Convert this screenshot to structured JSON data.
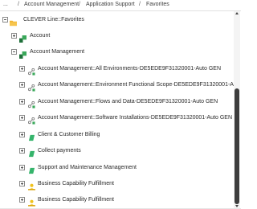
{
  "breadcrumb": {
    "items": [
      "/",
      "Account Management",
      "/",
      "Application Support",
      "/",
      "Favorites"
    ],
    "leading": "..."
  },
  "tree": {
    "root": {
      "label": "CLEVER Line::Favorites",
      "state": "expanded",
      "icon": "folder-icon"
    },
    "nodes": [
      {
        "label": "Account",
        "state": "collapsed",
        "icon": "capability-icon",
        "depth": 1
      },
      {
        "label": "Account Management",
        "state": "expanded",
        "icon": "capability-icon",
        "depth": 1
      },
      {
        "label": "Account Management::All Environments-DE5EDE9F31320001-Auto GEN",
        "state": "collapsed",
        "icon": "relation-icon",
        "depth": 2
      },
      {
        "label": "Account Management::Environment Functional Scope-DE5EDE9F31320001-Auto GEN",
        "state": "collapsed",
        "icon": "relation-icon",
        "depth": 2
      },
      {
        "label": "Account Management::Flows and Data-DE5EDE9F31320001-Auto GEN",
        "state": "collapsed",
        "icon": "relation-icon",
        "depth": 2
      },
      {
        "label": "Account Management::Software Installations-DE5EDE9F31320001-Auto GEN",
        "state": "collapsed",
        "icon": "relation-icon",
        "depth": 2
      },
      {
        "label": "Client & Customer Billing",
        "state": "collapsed",
        "icon": "diamond-icon",
        "depth": 2
      },
      {
        "label": "Collect payments",
        "state": "collapsed",
        "icon": "diamond-icon",
        "depth": 2
      },
      {
        "label": "Support and Maintenance Management",
        "state": "collapsed",
        "icon": "diamond-icon",
        "depth": 2
      },
      {
        "label": "Business Capability Fulfillment",
        "state": "collapsed",
        "icon": "person-icon",
        "depth": 2
      },
      {
        "label": "Business Capability Fulfillment",
        "state": "collapsed",
        "icon": "person-icon",
        "depth": 2
      }
    ]
  },
  "colors": {
    "folder": "#f2b531",
    "capability_dark": "#1f6f3a",
    "capability_light": "#3aa85a",
    "relation": "#7a7a7a",
    "diamond": "#35b46b",
    "person": "#f0c21d"
  }
}
